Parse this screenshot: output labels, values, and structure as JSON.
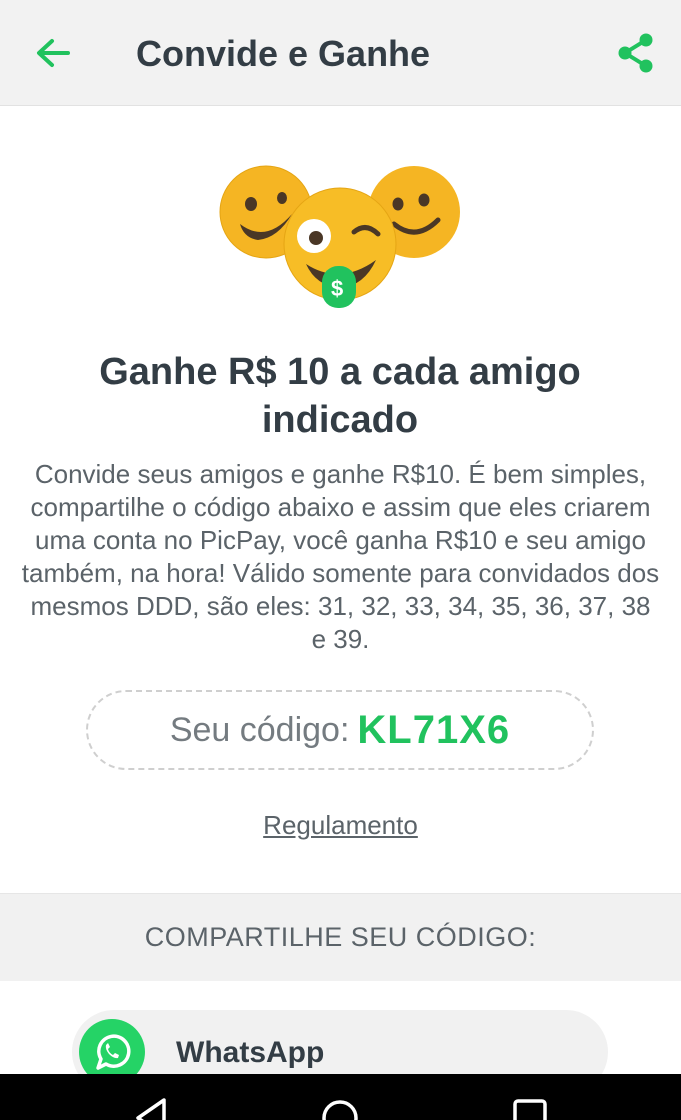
{
  "header": {
    "title": "Convide e Ganhe",
    "back_icon": "arrow-left-icon",
    "share_icon": "share-icon"
  },
  "hero": {
    "illustration": "emoji-faces-illustration",
    "dollar_sign": "$"
  },
  "main": {
    "headline": "Ganhe R$ 10 a cada amigo indicado",
    "description": "Convide seus amigos e ganhe R$10. É bem simples, compartilhe o código abaixo e assim que eles criarem uma conta no PicPay, você ganha R$10 e seu amigo também, na hora! Válido somente para convidados dos mesmos DDD, são eles: 31, 32, 33, 34, 35, 36, 37, 38 e 39.",
    "code_label": "Seu código:",
    "code_value": "KL71X6",
    "rules_link": "Regulamento"
  },
  "share": {
    "header": "COMPARTILHE SEU CÓDIGO:",
    "items": [
      {
        "label": "WhatsApp",
        "icon": "whatsapp-icon"
      }
    ]
  },
  "navbar": {
    "icons": [
      "back-triangle-icon",
      "home-circle-icon",
      "recents-square-icon"
    ]
  },
  "colors": {
    "accent_green": "#21c25e",
    "text_dark": "#333d45",
    "text_muted": "#5b6369",
    "appbar_bg": "#f2f2f2",
    "emoji_yellow": "#f7bd26",
    "whatsapp_green": "#25d366"
  }
}
